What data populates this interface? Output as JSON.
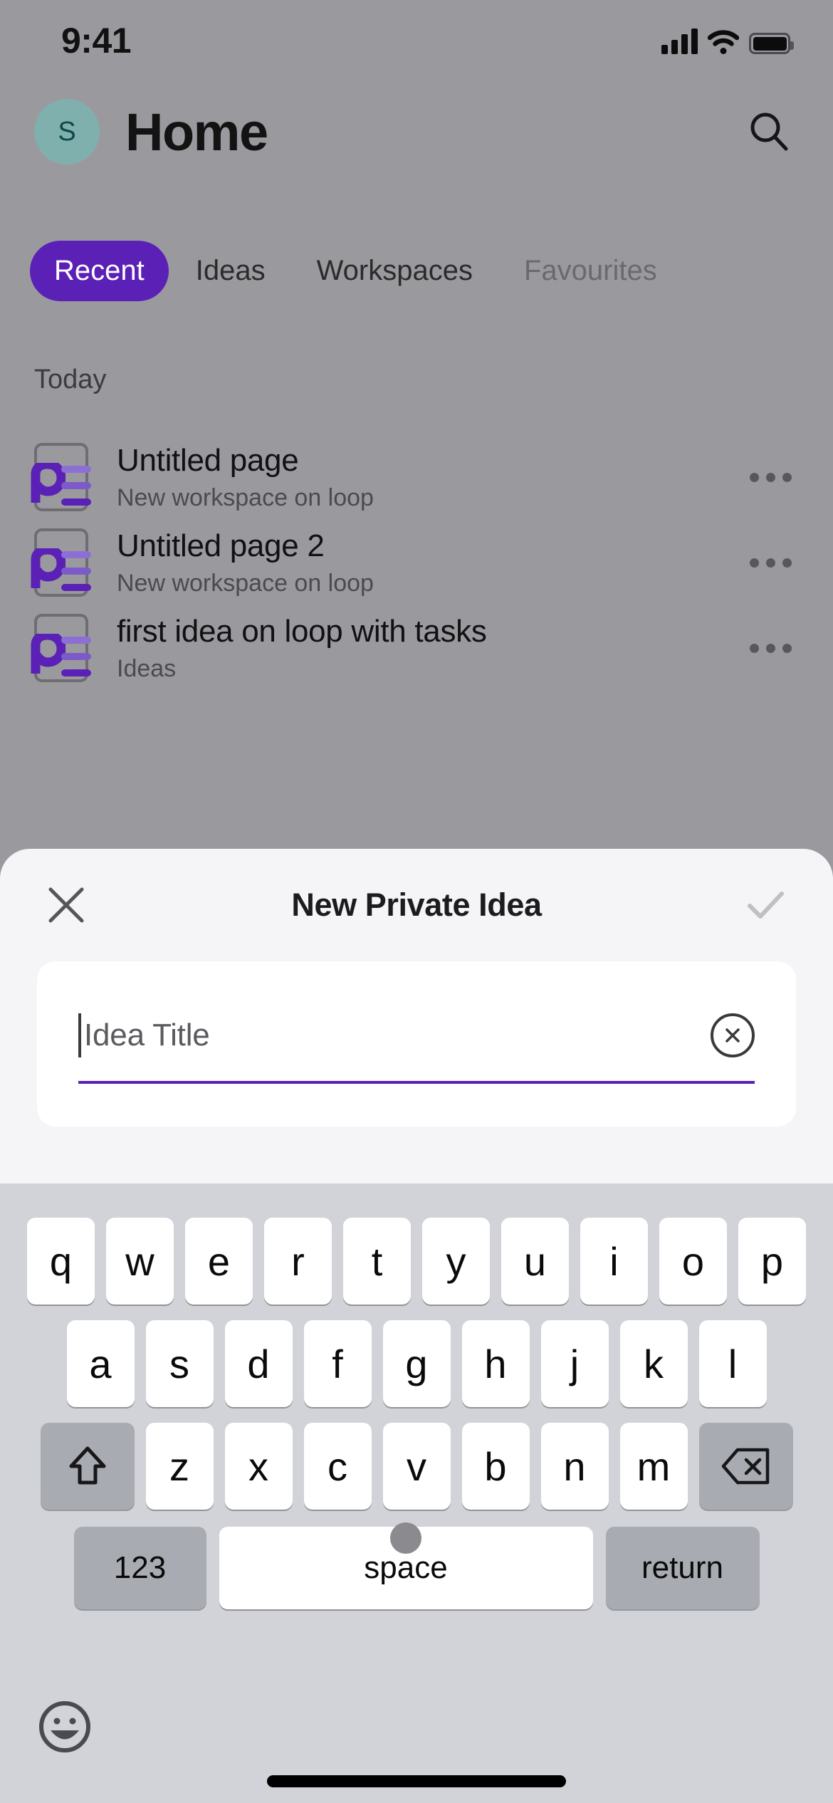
{
  "status_bar": {
    "time": "9:41",
    "icons": [
      "cellular-signal-icon",
      "wifi-icon",
      "battery-icon"
    ]
  },
  "header": {
    "avatar_initial": "S",
    "title": "Home",
    "search_icon": "search-icon",
    "avatar_color": "#7fb0ad"
  },
  "tabs": [
    {
      "label": "Recent",
      "active": true
    },
    {
      "label": "Ideas",
      "active": false
    },
    {
      "label": "Workspaces",
      "active": false
    },
    {
      "label": "Favourites",
      "active": false
    }
  ],
  "list": {
    "section_label": "Today",
    "items": [
      {
        "title": "Untitled page",
        "subtitle": "New workspace on loop",
        "icon": "loop-page-icon",
        "menu": "more-options-icon"
      },
      {
        "title": "Untitled page 2",
        "subtitle": "New workspace on loop",
        "icon": "loop-page-icon",
        "menu": "more-options-icon"
      },
      {
        "title": "first idea on loop with tasks",
        "subtitle": "Ideas",
        "icon": "loop-page-icon",
        "menu": "more-options-icon"
      }
    ]
  },
  "modal": {
    "title": "New Private Idea",
    "close_icon": "close-x-icon",
    "confirm_icon": "checkmark-icon",
    "confirm_enabled": false,
    "field": {
      "value": "",
      "placeholder": "Idea Title",
      "clear_icon": "clear-circle-x-icon",
      "underline_color": "#5b21b6"
    }
  },
  "keyboard": {
    "row1": [
      "q",
      "w",
      "e",
      "r",
      "t",
      "y",
      "u",
      "i",
      "o",
      "p"
    ],
    "row2": [
      "a",
      "s",
      "d",
      "f",
      "g",
      "h",
      "j",
      "k",
      "l"
    ],
    "row3": [
      "z",
      "x",
      "c",
      "v",
      "b",
      "n",
      "m"
    ],
    "shift_icon": "shift-arrow-icon",
    "backspace_icon": "backspace-delete-icon",
    "numbers_label": "123",
    "space_label": "space",
    "return_label": "return",
    "emoji_icon": "emoji-smiley-icon"
  },
  "theme": {
    "accent_purple": "#5b21b6",
    "dim_overlay": "#9a9a9e",
    "keyboard_bg": "#d1d3d9",
    "sheet_bg": "#f5f4f7"
  }
}
